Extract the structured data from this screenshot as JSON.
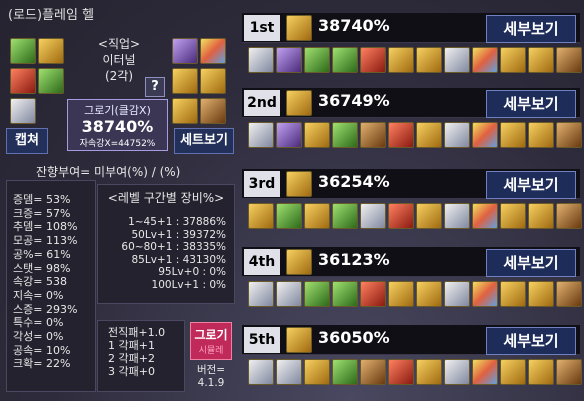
{
  "title": "(로드)플레임 헬",
  "character": {
    "job_label": "<직업>",
    "job_name": "이터널",
    "awakening": "(2각)",
    "help_label": "?"
  },
  "score": {
    "label": "그로기(클감X)",
    "value": "38740%",
    "sub": "자속강X=44752%"
  },
  "buttons": {
    "capture": "캡쳐",
    "set_view": "세트보기",
    "grogi_main": "그로기",
    "grogi_sub": "시뮬레"
  },
  "blessing_text": "잔향부여= 미부여(%) / (%)",
  "stats": [
    "증뎀= 53%",
    "크증= 57%",
    "추뎀= 108%",
    "모공= 113%",
    "공%= 61%",
    "스탯= 98%",
    "속강= 538",
    "지속= 0%",
    "스증= 293%",
    "특수= 0%",
    "각성= 0%",
    "공속= 10%",
    "크확= 22%"
  ],
  "level_box": {
    "header": "<레벨 구간별 장비%>",
    "rows": [
      "1~45+1 : 37886%",
      "50Lv+1 : 39372%",
      "60~80+1 : 38335%",
      "85Lv+1 : 43130%",
      "95Lv+0 : 0%",
      "100Lv+1 : 0%"
    ]
  },
  "transcend": [
    "전직패+1.0",
    "1 각패+1",
    "2 각패+2",
    "3 각패+0"
  ],
  "version": {
    "label": "버전=",
    "number": "4.1.9"
  },
  "rankings": [
    {
      "rank": "1st",
      "score": "38740%",
      "detail": "세부보기"
    },
    {
      "rank": "2nd",
      "score": "36749%",
      "detail": "세부보기"
    },
    {
      "rank": "3rd",
      "score": "36254%",
      "detail": "세부보기"
    },
    {
      "rank": "4th",
      "score": "36123%",
      "detail": "세부보기"
    },
    {
      "rank": "5th",
      "score": "36050%",
      "detail": "세부보기"
    }
  ],
  "icons": {
    "equipment": [
      "avatar-icon",
      "weapon-icon",
      "accessory-icon"
    ],
    "colors": {
      "background": "#2e2c3c",
      "accent_blue": "#1e2c5a",
      "grogi_pink": "#c02a5a"
    }
  }
}
